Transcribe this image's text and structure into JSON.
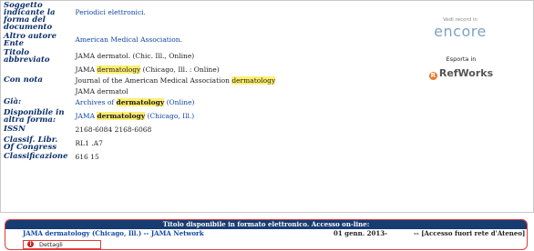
{
  "record": {
    "rows": [
      {
        "label": "Soggetto indicante la forma del documento",
        "value": "Periodici elettronici."
      },
      {
        "label": "Altro autore Ente",
        "value": "American Medical Association."
      },
      {
        "label": "Titolo abbreviato",
        "value": "JAMA dermatol. (Chic. Ill., Online)"
      },
      {
        "label": "",
        "value_prefix": "JAMA ",
        "value_hl": "dermatology",
        "value_suffix": " (Chicago, Ill. : Online)"
      },
      {
        "label": "Con nota",
        "value_prefix": "Journal of the American Medical Association ",
        "value_hl": "dermatology",
        "value_suffix": ""
      },
      {
        "label": "",
        "value": "JAMA dermatol"
      },
      {
        "label": "Già:",
        "value_prefix": "Archives of ",
        "value_hl": "dermatology",
        "value_suffix": " (Online)"
      },
      {
        "label": "Disponibile in altra forma:",
        "value_prefix": "JAMA ",
        "value_hl": "dermatology",
        "value_suffix": " (Chicago, Ill.)"
      },
      {
        "label": "ISSN",
        "value": "2168-6084 2168-6068"
      },
      {
        "label": "Classif. Libr. Of Congress",
        "value": "RL1 .A7"
      },
      {
        "label": "Classificazione",
        "value": "616 15"
      }
    ]
  },
  "side": {
    "encore_small": "Vedi record in",
    "encore_big": "encore",
    "refworks_small": "Esporta in",
    "refworks_big": "RefWorks",
    "refworks_icon_letter": "R"
  },
  "online": {
    "header": "Titolo disponibile in formato elettronico. Accesso on-line:",
    "link_text": "JAMA dermatology (Chicago, Ill.) -- JAMA Network",
    "date": "01 genn. 2013-",
    "access": "-- [Accesso fuori rete d'Ateneo]",
    "details_label": "Dettagli",
    "details_icon": "i"
  },
  "colors": {
    "label_blue": "#0b2f6b",
    "link_blue": "#0f47a3",
    "highlight": "#ffef70",
    "header_bg": "#173c72",
    "accent_red": "#e23a3a"
  }
}
